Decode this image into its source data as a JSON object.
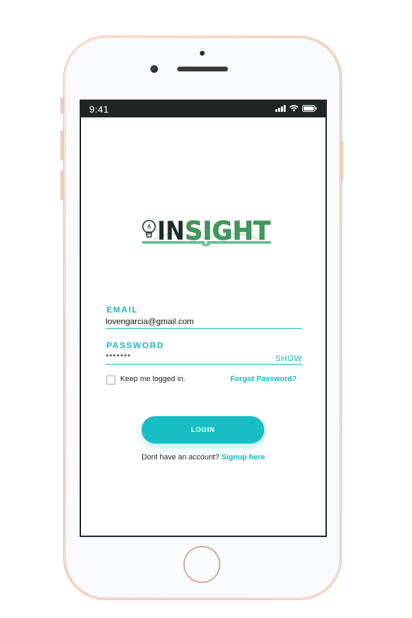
{
  "status_bar": {
    "time": "9:41"
  },
  "logo": {
    "text_dark": "IN",
    "text_green": "SIGHT",
    "icon": "lightbulb-icon"
  },
  "form": {
    "email": {
      "label": "EMAIL",
      "value": "lovengarcia@gmail.com"
    },
    "password": {
      "label": "PASSWORD",
      "value": "*******",
      "toggle_label": "SHOW"
    },
    "remember_me": {
      "label": "Keep me logged in.",
      "checked": false
    },
    "forgot_password": "Forgot Password?",
    "login_button": "LOGIN",
    "signup_prompt": "Dont have an account?",
    "signup_link": "Signup here"
  },
  "colors": {
    "accent": "#17b9bd",
    "button": "#17bfc4",
    "logo_dark": "#1f2d2a",
    "logo_green": "#3f9a5a",
    "logo_book": "#6cc199"
  }
}
